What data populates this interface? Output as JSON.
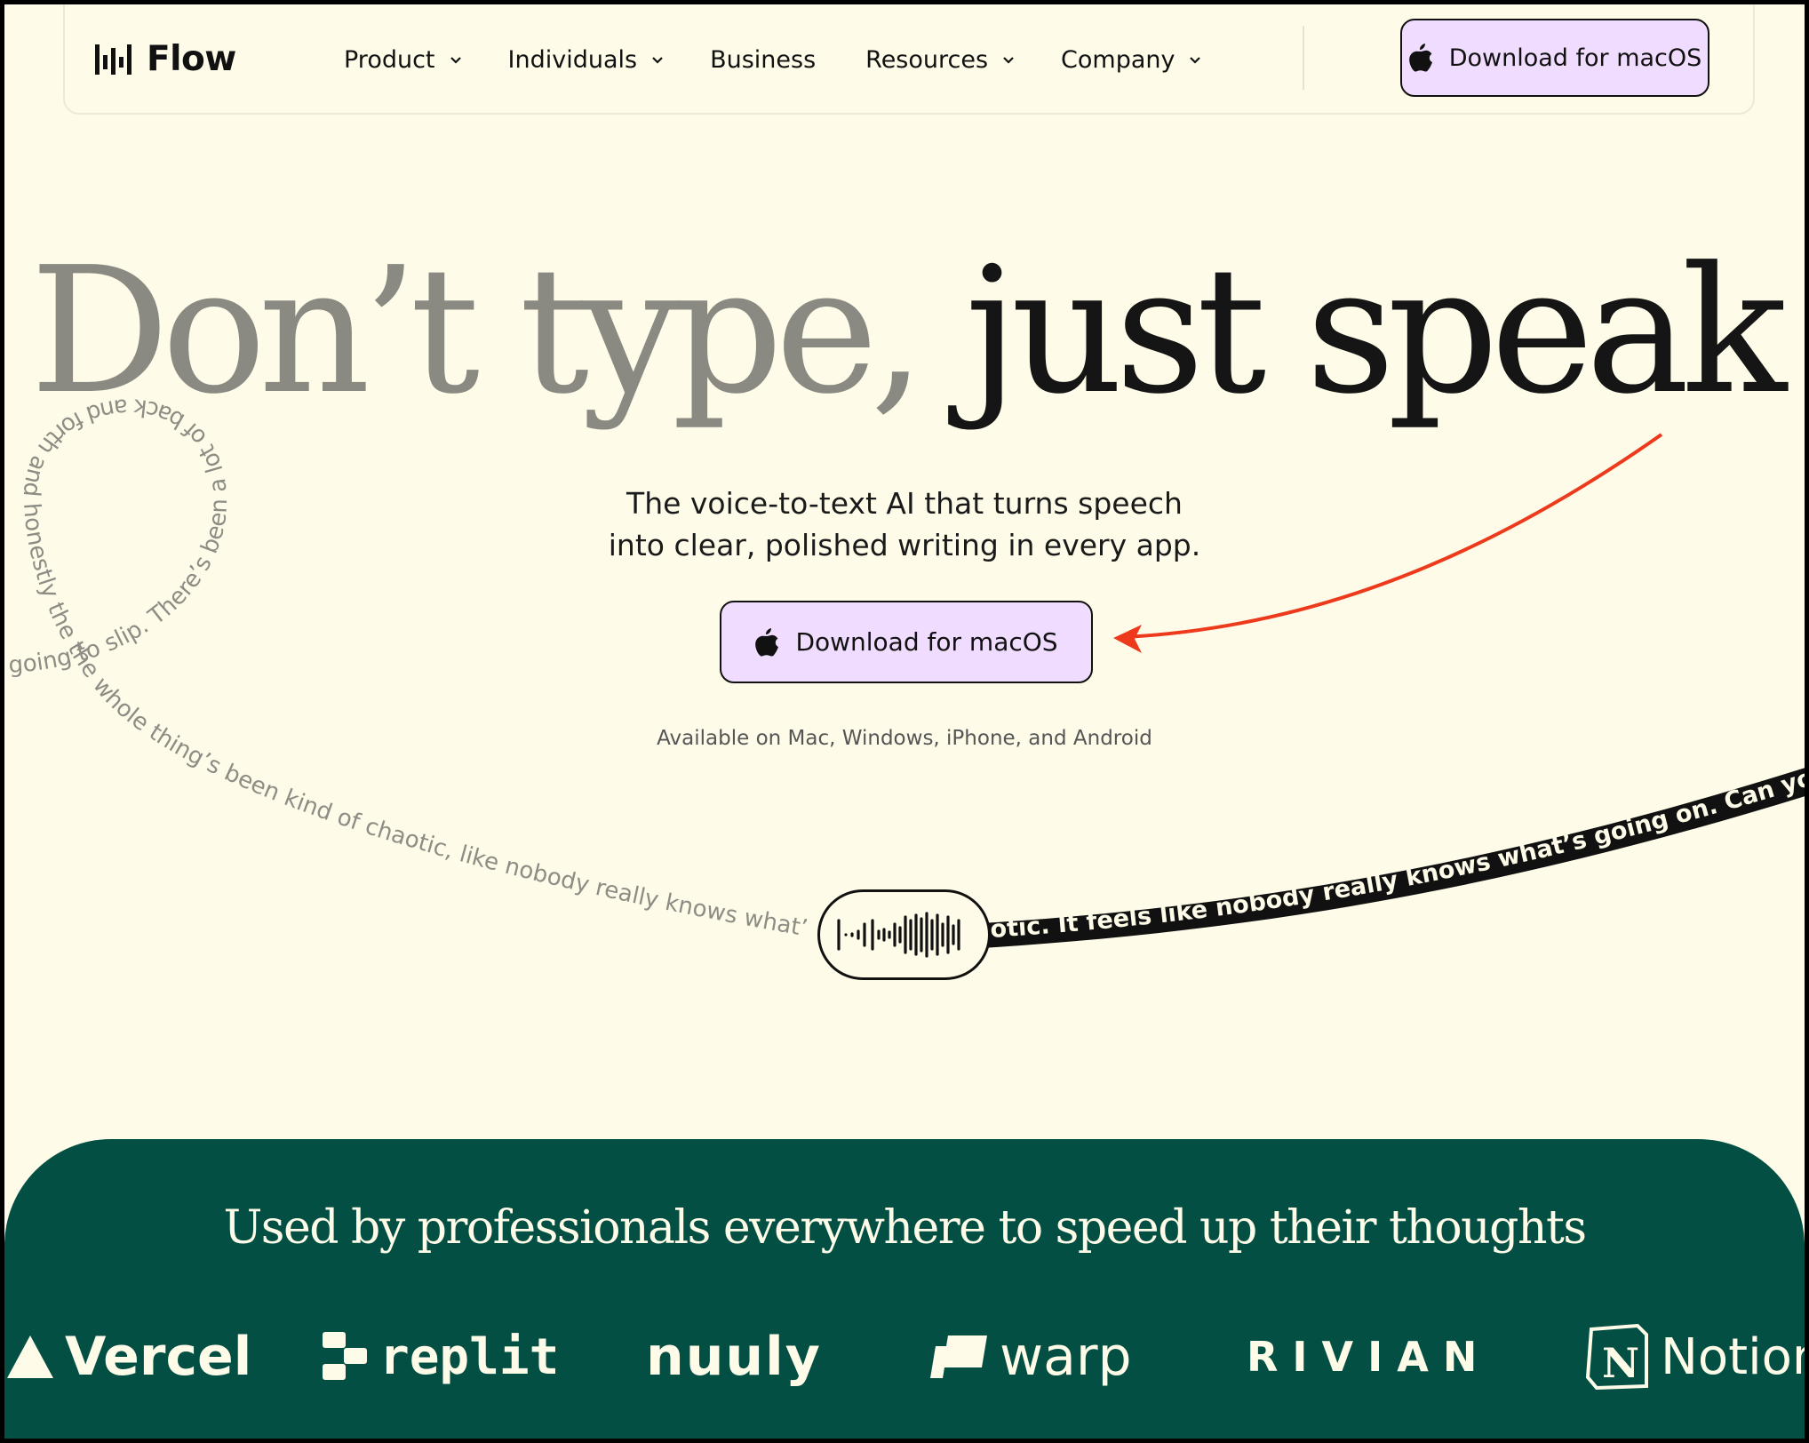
{
  "nav": {
    "brand": "Flow",
    "items": [
      {
        "label": "Product",
        "dropdown": true
      },
      {
        "label": "Individuals",
        "dropdown": true
      },
      {
        "label": "Business",
        "dropdown": false
      },
      {
        "label": "Resources",
        "dropdown": true
      },
      {
        "label": "Company",
        "dropdown": true
      }
    ],
    "cta_label": "Download for macOS"
  },
  "hero": {
    "title_part1": "Don’t type,",
    "title_part2": "just speak",
    "subtitle_line1": "The voice-to-text AI that turns speech",
    "subtitle_line2": "into clear, polished writing in every app.",
    "cta_label": "Download for macOS",
    "availability": "Available on Mac, Windows, iPhone, and Android"
  },
  "ribbons": {
    "spoken_text": "going to slip. There’s been a lot of back and forth and honestly the the whole thing’s been kind of chaotic, like nobody really knows what’s go",
    "polished_text": "otic. It feels like nobody really knows what’s going on. Can you check i"
  },
  "social_proof": {
    "title": "Used by professionals everywhere to speed up their thoughts",
    "logos": [
      "Vercel",
      "replit",
      "nuuly",
      "warp",
      "RIVIAN",
      "Notion"
    ]
  },
  "colors": {
    "background": "#fefce8",
    "button": "#f0dcff",
    "band": "#044f44",
    "arrow": "#ee3a1c"
  }
}
